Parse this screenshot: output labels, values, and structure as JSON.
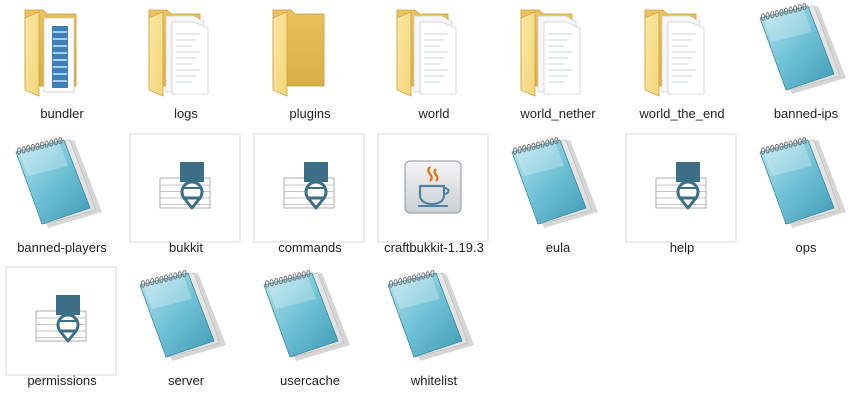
{
  "files": [
    {
      "label": "bundler",
      "icon": "folder-with-document-icon"
    },
    {
      "label": "logs",
      "icon": "folder-with-pages-icon"
    },
    {
      "label": "plugins",
      "icon": "empty-folder-icon"
    },
    {
      "label": "world",
      "icon": "folder-with-pages-icon"
    },
    {
      "label": "world_nether",
      "icon": "folder-with-pages-icon"
    },
    {
      "label": "world_the_end",
      "icon": "folder-with-pages-icon"
    },
    {
      "label": "banned-ips",
      "icon": "notepad-icon"
    },
    {
      "label": "banned-players",
      "icon": "notepad-icon"
    },
    {
      "label": "bukkit",
      "icon": "yaml-file-icon"
    },
    {
      "label": "commands",
      "icon": "yaml-file-icon"
    },
    {
      "label": "craftbukkit-1.19.3",
      "icon": "java-jar-icon"
    },
    {
      "label": "eula",
      "icon": "notepad-icon"
    },
    {
      "label": "help",
      "icon": "yaml-file-icon"
    },
    {
      "label": "ops",
      "icon": "notepad-icon"
    },
    {
      "label": "permissions",
      "icon": "yaml-file-icon"
    },
    {
      "label": "server",
      "icon": "notepad-icon"
    },
    {
      "label": "usercache",
      "icon": "notepad-icon"
    },
    {
      "label": "whitelist",
      "icon": "notepad-icon"
    }
  ],
  "colors": {
    "folder_front": "#F3D679",
    "folder_back": "#E9C35D",
    "notepad_cover": "#6FC1D6",
    "yaml_badge": "#3C6E86",
    "java_cup": "#E76F00",
    "java_steam": "#5382A1"
  }
}
